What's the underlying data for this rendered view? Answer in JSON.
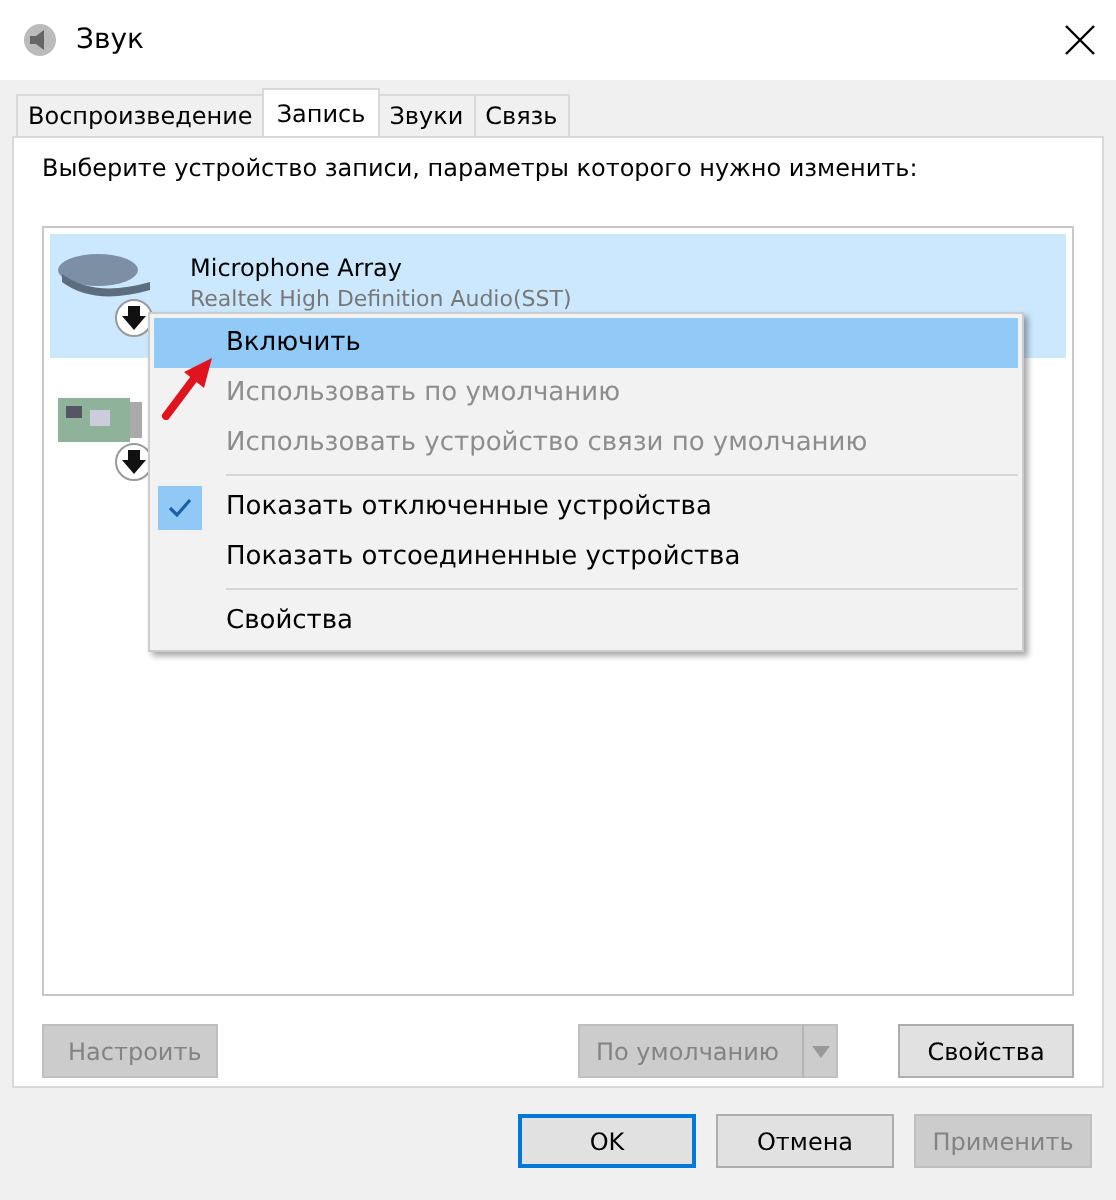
{
  "window": {
    "title": "Звук"
  },
  "tabs": [
    {
      "label": "Воспроизведение",
      "selected": false
    },
    {
      "label": "Запись",
      "selected": true
    },
    {
      "label": "Звуки",
      "selected": false
    },
    {
      "label": "Связь",
      "selected": false
    }
  ],
  "instruction": "Выберите устройство записи, параметры которого нужно изменить:",
  "devices": [
    {
      "kind": "microphone",
      "name": "Microphone Array",
      "detail": "Realtek High Definition Audio(SST)",
      "selected": true,
      "disabled": true
    },
    {
      "kind": "board",
      "selected": false,
      "disabled": true
    }
  ],
  "context_menu": [
    {
      "kind": "item",
      "label": "Включить",
      "selected": true,
      "disabled": false,
      "checked": false
    },
    {
      "kind": "item",
      "label": "Использовать по умолчанию",
      "selected": false,
      "disabled": true,
      "checked": false
    },
    {
      "kind": "item",
      "label": "Использовать устройство связи по умолчанию",
      "selected": false,
      "disabled": true,
      "checked": false
    },
    {
      "kind": "separator"
    },
    {
      "kind": "item",
      "label": "Показать отключенные устройства",
      "selected": false,
      "disabled": false,
      "checked": true
    },
    {
      "kind": "item",
      "label": "Показать отсоединенные устройства",
      "selected": false,
      "disabled": false,
      "checked": false
    },
    {
      "kind": "separator"
    },
    {
      "kind": "item",
      "label": "Свойства",
      "selected": false,
      "disabled": false,
      "checked": false
    }
  ],
  "panel_buttons": [
    {
      "kind": "button",
      "label": "Настроить",
      "disabled": true
    },
    {
      "kind": "split",
      "label": "По умолчанию",
      "disabled": true
    },
    {
      "kind": "button",
      "label": "Свойства",
      "disabled": false
    }
  ],
  "dialog_buttons": [
    {
      "label": "OK",
      "disabled": false,
      "default": true
    },
    {
      "label": "Отмена",
      "disabled": false,
      "default": false
    },
    {
      "label": "Применить",
      "disabled": true,
      "default": false
    }
  ]
}
